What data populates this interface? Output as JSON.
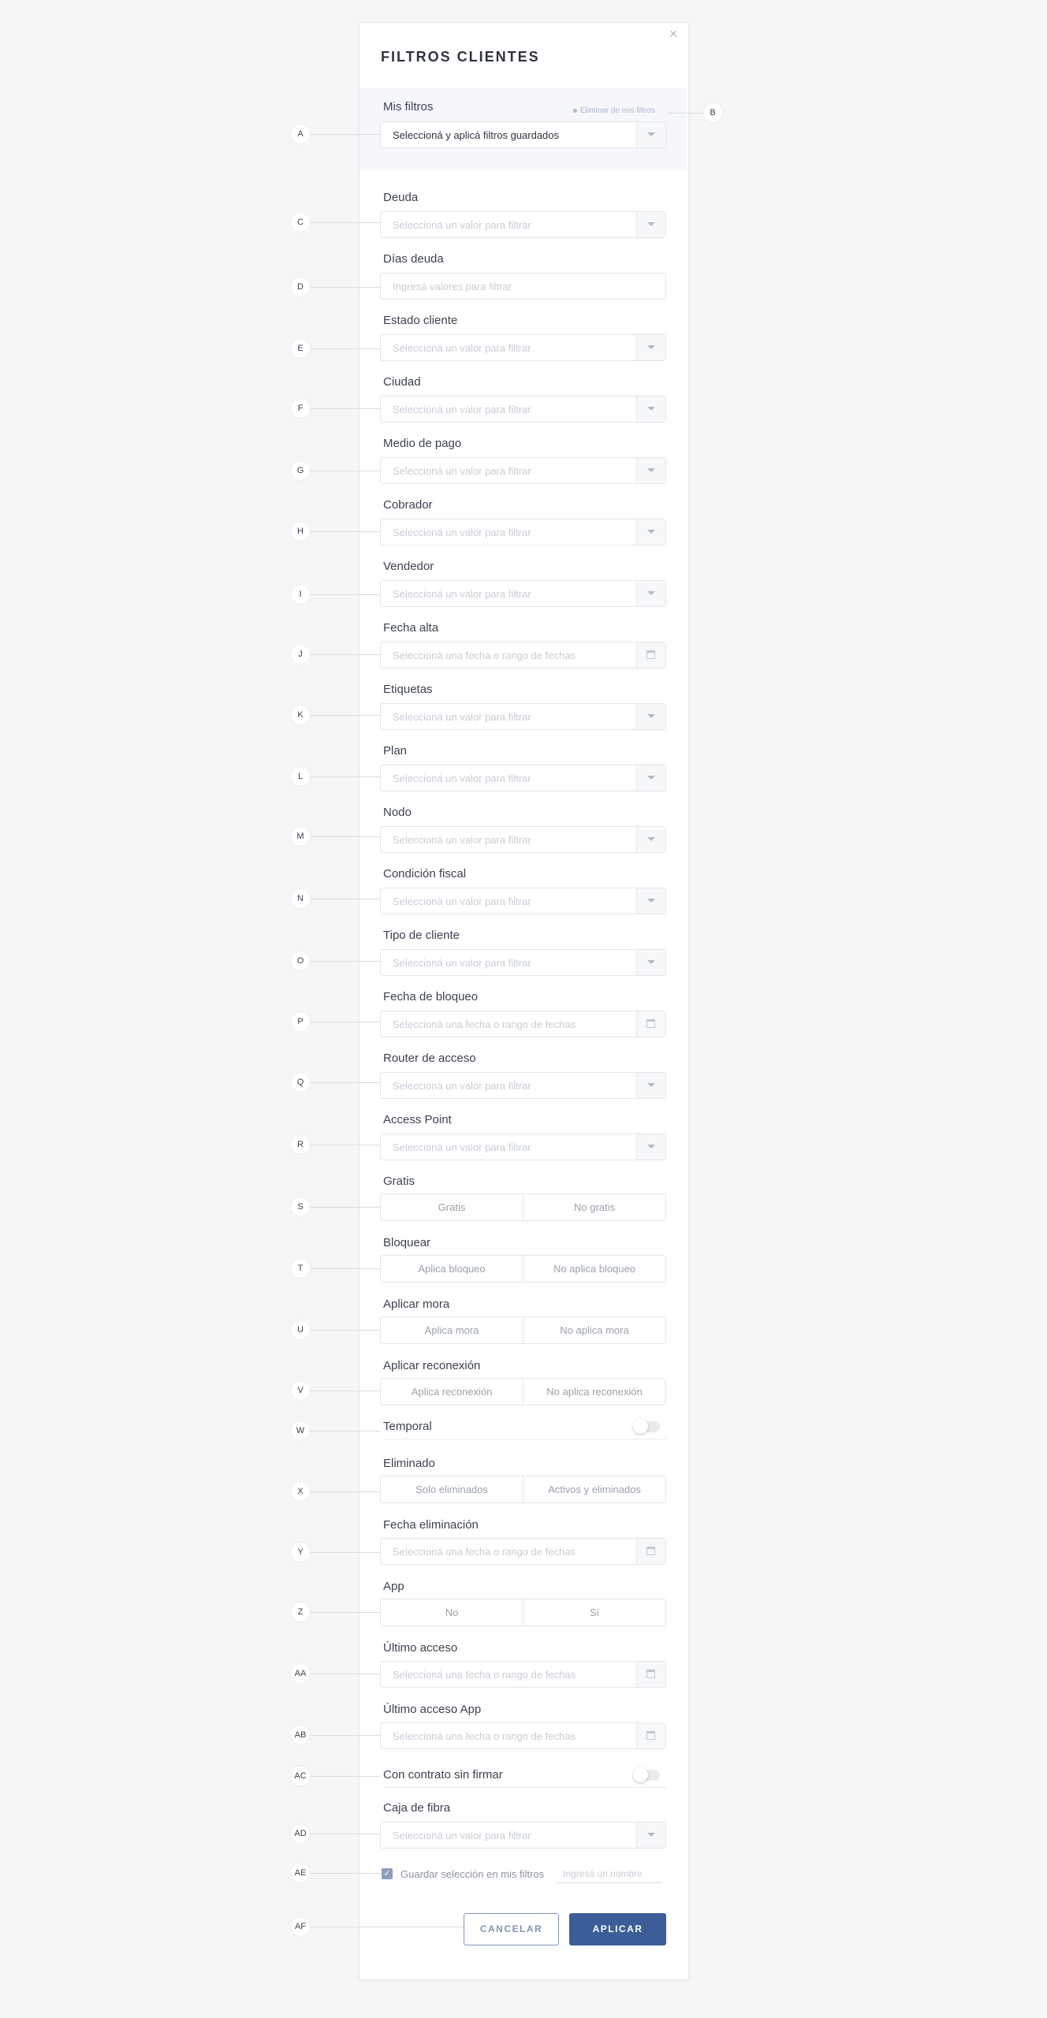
{
  "dialog": {
    "title": "FILTROS CLIENTES",
    "close_icon": "close-icon"
  },
  "mis_filtros": {
    "label": "Mis filtros",
    "delete_link": "Eliminar de mis filtros",
    "select_value": "Seleccioná y aplicá filtros guardados"
  },
  "fields": {
    "deuda": {
      "label": "Deuda",
      "placeholder": "Seleccioná un valor para filtrar"
    },
    "dias_deuda": {
      "label": "Días deuda",
      "placeholder": "Ingresá valores para filtrar"
    },
    "estado_cliente": {
      "label": "Estado cliente",
      "placeholder": "Seleccioná un valor para filtrar"
    },
    "ciudad": {
      "label": "Ciudad",
      "placeholder": "Seleccioná un valor para filtrar"
    },
    "medio_pago": {
      "label": "Medio de pago",
      "placeholder": "Seleccioná un valor para filtrar"
    },
    "cobrador": {
      "label": "Cobrador",
      "placeholder": "Seleccioná un valor para filtrar"
    },
    "vendedor": {
      "label": "Vendedor",
      "placeholder": "Seleccioná un valor para filtrar"
    },
    "fecha_alta": {
      "label": "Fecha alta",
      "placeholder": "Seleccioná una fecha o rango de fechas"
    },
    "etiquetas": {
      "label": "Etiquetas",
      "placeholder": "Seleccioná un valor para filtrar"
    },
    "plan": {
      "label": "Plan",
      "placeholder": "Seleccioná un valor para filtrar"
    },
    "nodo": {
      "label": "Nodo",
      "placeholder": "Seleccioná un valor para filtrar"
    },
    "condicion_fiscal": {
      "label": "Condición fiscal",
      "placeholder": "Seleccioná un valor para filtrar"
    },
    "tipo_cliente": {
      "label": "Tipo de cliente",
      "placeholder": "Seleccioná un valor para filtrar"
    },
    "fecha_bloqueo": {
      "label": "Fecha de bloqueo",
      "placeholder": "Seleccioná una fecha o rango de fechas"
    },
    "router_acceso": {
      "label": "Router de acceso",
      "placeholder": "Seleccioná un valor para filtrar"
    },
    "access_point": {
      "label": "Access Point",
      "placeholder": "Seleccioná un valor para filtrar"
    },
    "gratis": {
      "label": "Gratis",
      "option_a": "Gratis",
      "option_b": "No gratis"
    },
    "bloquear": {
      "label": "Bloquear",
      "option_a": "Aplica bloqueo",
      "option_b": "No aplica bloqueo"
    },
    "aplicar_mora": {
      "label": "Aplicar mora",
      "option_a": "Aplica mora",
      "option_b": "No aplica mora"
    },
    "aplicar_reconexion": {
      "label": "Aplicar reconexión",
      "option_a": "Aplica reconexión",
      "option_b": "No aplica reconexión"
    },
    "temporal": {
      "label": "Temporal",
      "on": false
    },
    "eliminado": {
      "label": "Eliminado",
      "option_a": "Solo eliminados",
      "option_b": "Activos y eliminados"
    },
    "fecha_eliminacion": {
      "label": "Fecha eliminación",
      "placeholder": "Seleccioná una fecha o rango de fechas"
    },
    "app": {
      "label": "App",
      "option_a": "No",
      "option_b": "Sí"
    },
    "ultimo_acceso": {
      "label": "Último acceso",
      "placeholder": "Seleccioná una fecha o rango de fechas"
    },
    "ultimo_acceso_app": {
      "label": "Último acceso App",
      "placeholder": "Seleccioná una fecha o rango de fechas"
    },
    "contrato_sin_firmar": {
      "label": "Con contrato sin firmar",
      "on": false
    },
    "caja_fibra": {
      "label": "Caja de fibra",
      "placeholder": "Seleccioná un valor para filtrar"
    }
  },
  "save": {
    "checked": true,
    "label": "Guardar selección en mis filtros",
    "name_placeholder": "Ingresá un nombre"
  },
  "buttons": {
    "cancel": "CANCELAR",
    "apply": "APLICAR"
  },
  "annotations": [
    "A",
    "B",
    "C",
    "D",
    "E",
    "F",
    "G",
    "H",
    "I",
    "J",
    "K",
    "L",
    "M",
    "N",
    "O",
    "P",
    "Q",
    "R",
    "S",
    "T",
    "U",
    "V",
    "W",
    "X",
    "Y",
    "Z",
    "AA",
    "AB",
    "AC",
    "AD",
    "AE",
    "AF"
  ],
  "colors": {
    "primary": "#3b5d98",
    "background": "#f6f6f7",
    "mis_filtros_bg": "#f5f7fb"
  }
}
